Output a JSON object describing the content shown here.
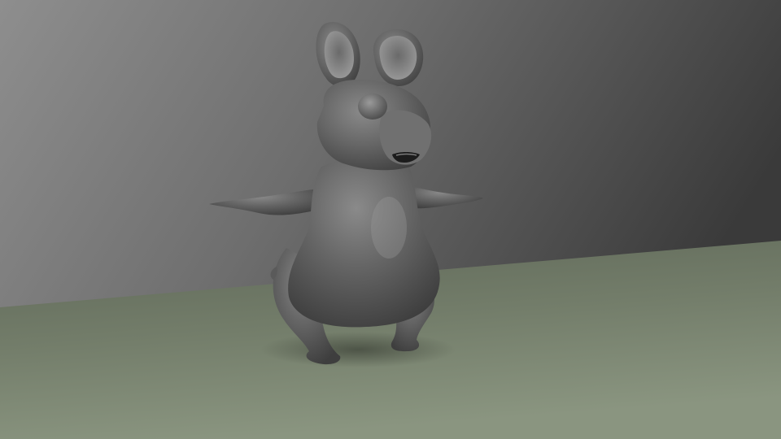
{
  "scene": {
    "subject": "mouse-character-render",
    "colors": {
      "wall_light": "#8e8e8e",
      "wall_dark": "#3a3a3a",
      "floor_light": "#8a9580",
      "floor_dark": "#5f6858",
      "body_light": "#8a8a8a",
      "body_mid": "#666666",
      "body_dark": "#3e3e3e",
      "mouth_dark": "#1c1c1c"
    }
  }
}
